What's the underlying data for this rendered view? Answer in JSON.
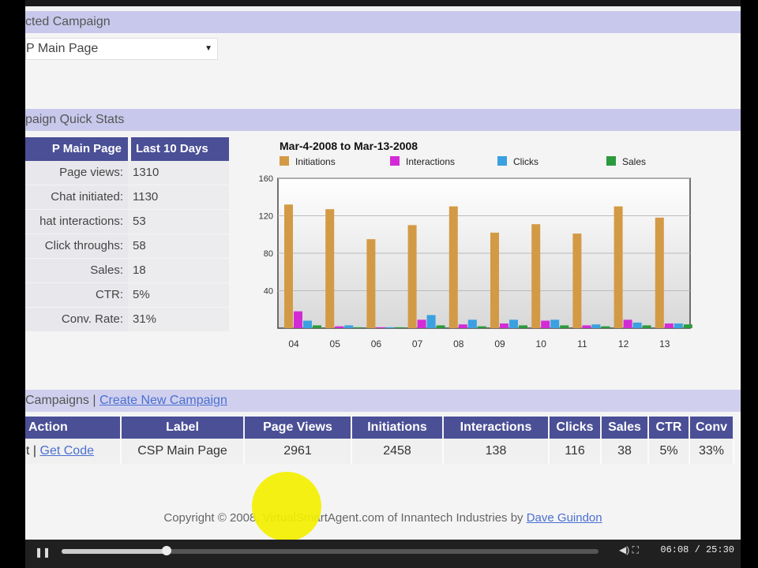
{
  "sections": {
    "selected_campaign": "cted Campaign",
    "quick_stats": "paign Quick Stats"
  },
  "campaign_select": {
    "value": "P Main Page"
  },
  "stats": {
    "header_left": "P Main Page",
    "header_right": "Last 10 Days",
    "rows": [
      {
        "label": "Page views:",
        "value": "1310"
      },
      {
        "label": "Chat initiated:",
        "value": "1130"
      },
      {
        "label": "hat interactions:",
        "value": "53"
      },
      {
        "label": "Click throughs:",
        "value": "58"
      },
      {
        "label": "Sales:",
        "value": "18"
      },
      {
        "label": "CTR:",
        "value": "5%"
      },
      {
        "label": "Conv. Rate:",
        "value": "31%"
      }
    ]
  },
  "chart_data": {
    "type": "bar",
    "title": "Mar-4-2008 to Mar-13-2008",
    "categories": [
      "04",
      "05",
      "06",
      "07",
      "08",
      "09",
      "10",
      "11",
      "12",
      "13"
    ],
    "series": [
      {
        "name": "Initiations",
        "color": "#d39a45",
        "values": [
          132,
          127,
          95,
          110,
          130,
          102,
          111,
          101,
          130,
          118
        ]
      },
      {
        "name": "Interactions",
        "color": "#d22bd6",
        "values": [
          18,
          2,
          1,
          9,
          4,
          5,
          8,
          3,
          9,
          5
        ]
      },
      {
        "name": "Clicks",
        "color": "#3aa0e0",
        "values": [
          8,
          3,
          1,
          14,
          9,
          9,
          9,
          4,
          6,
          5
        ]
      },
      {
        "name": "Sales",
        "color": "#2b9a3c",
        "values": [
          3,
          1,
          1,
          3,
          2,
          3,
          3,
          2,
          3,
          4
        ]
      }
    ],
    "yticks": [
      "40",
      "80",
      "120",
      "160"
    ],
    "ylim": [
      0,
      160
    ],
    "grid": true,
    "legend": "top"
  },
  "campaigns_bar": {
    "label": "Campaigns |",
    "link": "Create New Campaign"
  },
  "table": {
    "headers": [
      "Action",
      "Label",
      "Page Views",
      "Initiations",
      "Interactions",
      "Clicks",
      "Sales",
      "CTR",
      "Conv"
    ],
    "row": {
      "action_prefix": "t |",
      "action_link": "Get Code",
      "label": "CSP Main Page",
      "page_views": "2961",
      "initiations": "2458",
      "interactions": "138",
      "clicks": "116",
      "sales": "38",
      "ctr": "5%",
      "conv": "33%"
    }
  },
  "footer": {
    "text": "Copyright © 2008, VirtualSmartAgent.com of Innantech Industries by",
    "link": "Dave Guindon"
  },
  "player": {
    "time": "06:08 / 25:30",
    "progress": 0.195
  }
}
